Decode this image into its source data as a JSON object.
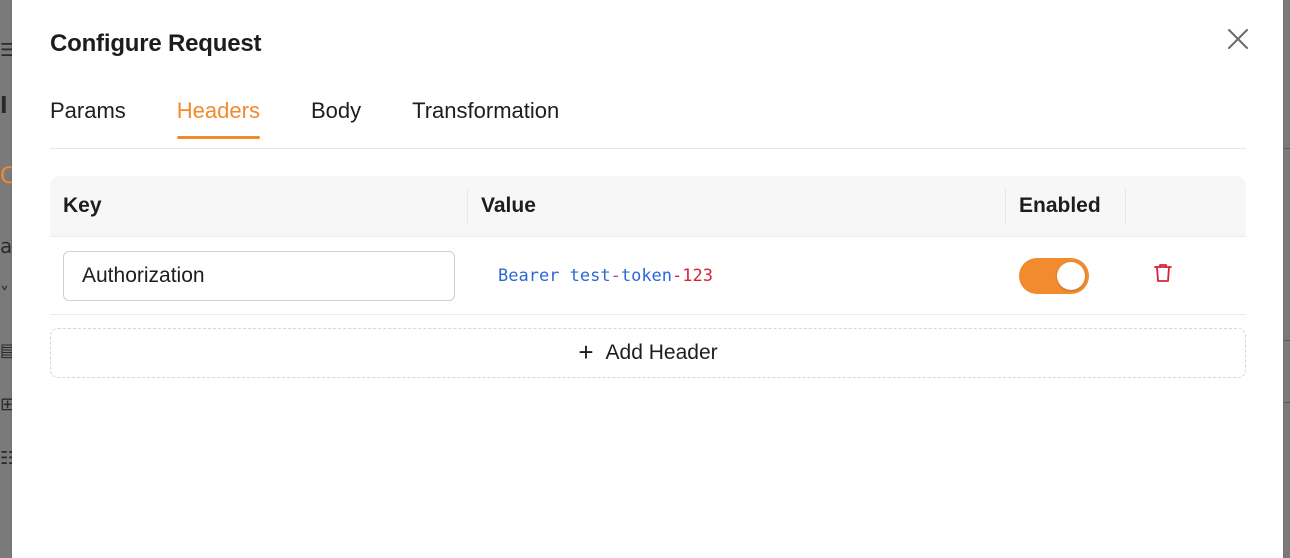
{
  "modal": {
    "title": "Configure Request"
  },
  "tabs": [
    {
      "label": "Params",
      "active": false
    },
    {
      "label": "Headers",
      "active": true
    },
    {
      "label": "Body",
      "active": false
    },
    {
      "label": "Transformation",
      "active": false
    }
  ],
  "table": {
    "columns": {
      "key": "Key",
      "value": "Value",
      "enabled": "Enabled"
    },
    "rows": [
      {
        "key": "Authorization",
        "value_parts": {
          "prefix": "Bearer test",
          "dash1": "-",
          "mid": "token",
          "dash2": "-",
          "suffix": "123"
        },
        "enabled": true
      }
    ]
  },
  "add_header_label": "Add Header",
  "colors": {
    "accent": "#f28a2e",
    "danger": "#d8233a",
    "token_blue": "#2d67d6"
  },
  "icons": {
    "close": "close-icon",
    "delete": "trash-icon",
    "add": "plus-icon"
  }
}
